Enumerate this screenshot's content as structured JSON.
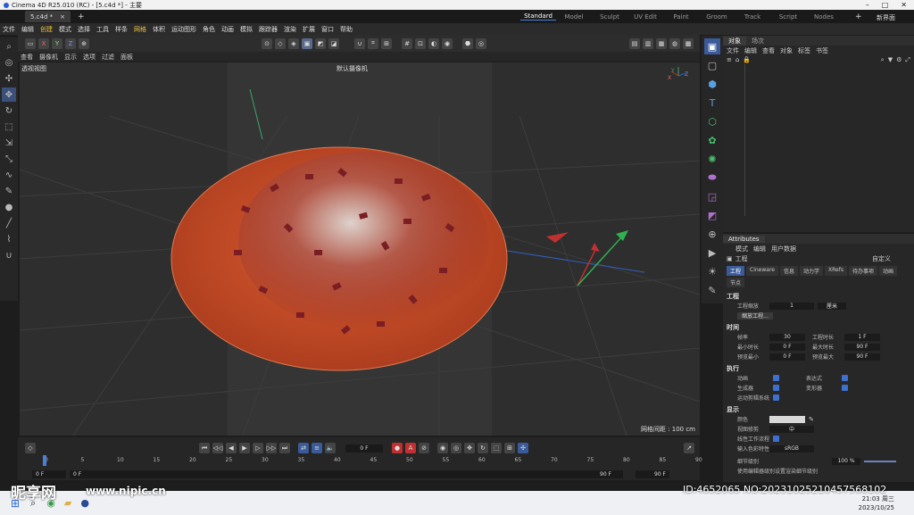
{
  "window": {
    "title": "Cinema 4D R25.010 (RC) - [5.c4d *] - 主要"
  },
  "tabs": {
    "doc_tab": "5.c4d *",
    "add": "+"
  },
  "layouts": [
    "Standard",
    "Model",
    "Sculpt",
    "UV Edit",
    "Paint",
    "Groom",
    "Track",
    "Script",
    "Nodes"
  ],
  "layout_plus": "+",
  "new_interface": "新界面",
  "menu": [
    "文件",
    "编辑",
    "创建",
    "模式",
    "选择",
    "工具",
    "样条",
    "网格",
    "体积",
    "运动图形",
    "角色",
    "动画",
    "模拟",
    "跟踪器",
    "渲染",
    "扩展",
    "窗口",
    "帮助"
  ],
  "menu_highlight": [
    "创建",
    "网格"
  ],
  "viewport": {
    "menu": [
      "查看",
      "摄像机",
      "显示",
      "选项",
      "过滤",
      "面板"
    ],
    "label": "透视视图",
    "camera": "默认摄像机",
    "grid_info": "网格间距 : 100 cm",
    "axis_labels": {
      "y": "Y",
      "z": "Z",
      "x": "X"
    }
  },
  "toolbar_axes": [
    "X",
    "Y",
    "Z"
  ],
  "timeline": {
    "frame_field": "0 F",
    "ruler": [
      "0",
      "5",
      "10",
      "15",
      "20",
      "25",
      "30",
      "35",
      "40",
      "45",
      "50",
      "55",
      "60",
      "65",
      "70",
      "75",
      "80",
      "85",
      "90"
    ],
    "start_a": "0 F",
    "start_b": "0 F",
    "end_a": "90 F",
    "end_b": "90 F"
  },
  "objects": {
    "tabs": [
      "对象",
      "场次"
    ],
    "menu": [
      "文件",
      "编辑",
      "查看",
      "对象",
      "标签",
      "书签"
    ]
  },
  "attributes": {
    "title": "Attributes",
    "menu": [
      "模式",
      "编辑",
      "用户数据"
    ],
    "object": "工程",
    "preset": "自定义",
    "tabs": [
      "工程",
      "Cineware",
      "信息",
      "动力学",
      "XRefs",
      "待办事项",
      "动画",
      "节点"
    ],
    "section": "工程",
    "scale_label": "工程缩放",
    "scale_value": "1",
    "scale_unit": "厘米",
    "scale_btn": "缩放工程...",
    "time_header": "时间",
    "time_rows": [
      {
        "l1": "帧率",
        "v1": "30",
        "l2": "工程时长",
        "v2": "1 F"
      },
      {
        "l1": "最小时长",
        "v1": "0 F",
        "l2": "最大时长",
        "v2": "90 F"
      },
      {
        "l1": "预览最小",
        "v1": "0 F",
        "l2": "预览最大",
        "v2": "90 F"
      }
    ],
    "exec_header": "执行",
    "exec_rows": [
      {
        "l1": "动画",
        "l2": "表达式"
      },
      {
        "l1": "生成器",
        "l2": "变形器"
      },
      {
        "l1": "运动剪辑系统",
        "l2": ""
      }
    ],
    "display_header": "显示",
    "color_label": "颜色",
    "view_clip_label": "视图修剪",
    "view_clip_value": "中",
    "linear_label": "线性工作流程",
    "input_color_label": "输入色彩特性",
    "input_color_value": "sRGB",
    "lod_label": "细节级别",
    "lod_value": "100 %",
    "footer_text": "使用编辑器级别设置渲染细节级别"
  },
  "taskbar": {
    "time": "21:03",
    "day": "周三",
    "date": "2023/10/25"
  },
  "watermark": {
    "logo": "昵享网",
    "url": "www.nipic.cn",
    "id": "ID:4652065 NO:20231025210457568102"
  },
  "colors": {
    "accent": "#3a5a9a",
    "highlight": "#f0c040",
    "selection_blue": "#3d6fd0"
  }
}
